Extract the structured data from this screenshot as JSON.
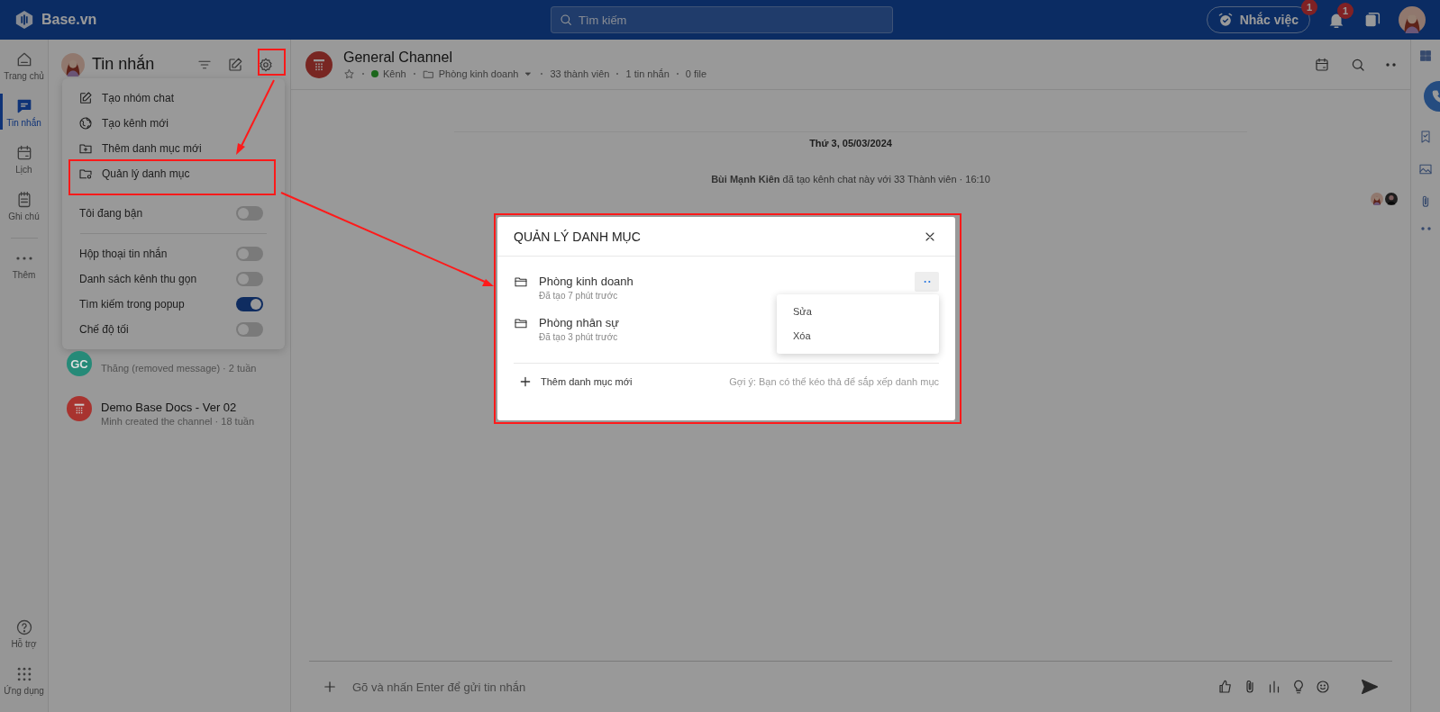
{
  "topbar": {
    "logo": "Base.vn",
    "search_placeholder": "Tìm kiếm",
    "reminder": {
      "label": "Nhắc việc",
      "badge": "1"
    },
    "notifications_badge": "1"
  },
  "rail": {
    "items": [
      {
        "label": "Trang chủ",
        "kind": "home",
        "selected": false
      },
      {
        "label": "Tin nhắn",
        "kind": "chat",
        "selected": true
      },
      {
        "label": "Lịch",
        "kind": "calendar",
        "selected": false
      },
      {
        "label": "Ghi chú",
        "kind": "note",
        "selected": false
      },
      {
        "label": "Thêm",
        "kind": "more",
        "selected": false
      }
    ],
    "bottom": [
      {
        "label": "Hỗ trợ",
        "kind": "help"
      },
      {
        "label": "Ứng dụng",
        "kind": "apps"
      }
    ]
  },
  "messages_panel": {
    "title": "Tin nhắn",
    "conversations": [
      {
        "kind": "initials",
        "initials": "GC",
        "color": "#268a78",
        "subtitle": "Thăng (removed message) · 2 tuần"
      },
      {
        "kind": "icon",
        "color": "#a8332f",
        "title": "Demo Base Docs - Ver 02",
        "subtitle": "Minh created the channel · 18 tuần"
      }
    ]
  },
  "settings_menu": {
    "actions": [
      {
        "label": "Tạo nhóm chat",
        "kind": "edit"
      },
      {
        "label": "Tạo kênh mới",
        "kind": "globe"
      },
      {
        "label": "Thêm danh mục mới",
        "kind": "folder-add"
      },
      {
        "label": "Quản lý danh mục",
        "kind": "folder-gear"
      }
    ],
    "toggle_groups": [
      [
        {
          "label": "Tôi đang bận",
          "on": false
        }
      ],
      [
        {
          "label": "Hộp thoại tin nhắn",
          "on": false
        },
        {
          "label": "Danh sách kênh thu gọn",
          "on": false
        },
        {
          "label": "Tìm kiếm trong popup",
          "on": true
        },
        {
          "label": "Chế độ tối",
          "on": false
        }
      ]
    ]
  },
  "channel": {
    "name": "General Channel",
    "type": "Kênh",
    "category": "Phòng kinh doanh",
    "members": "33 thành viên",
    "messages": "1 tin nhắn",
    "files": "0 file"
  },
  "chat": {
    "date": "Thứ 3, 05/03/2024",
    "system_message": "**Bùi Mạnh Kiên** đã tạo kênh chat này với 33 Thành viên · 16:10"
  },
  "composer": {
    "placeholder": "Gõ và nhấn Enter để gửi tin nhắn"
  },
  "modal": {
    "title": "QUẢN LÝ DANH MỤC",
    "categories": [
      {
        "name": "Phòng kinh doanh",
        "created": "Đã tạo 7 phút trước",
        "menu_open": true
      },
      {
        "name": "Phòng nhân sự",
        "created": "Đã tạo 3 phút trước",
        "menu_open": false
      }
    ],
    "category_menu": [
      "Sửa",
      "Xóa"
    ],
    "add_label": "Thêm danh mục mới",
    "hint": "Gợi ý: Bạn có thể kéo thả để sắp xếp danh mục"
  }
}
